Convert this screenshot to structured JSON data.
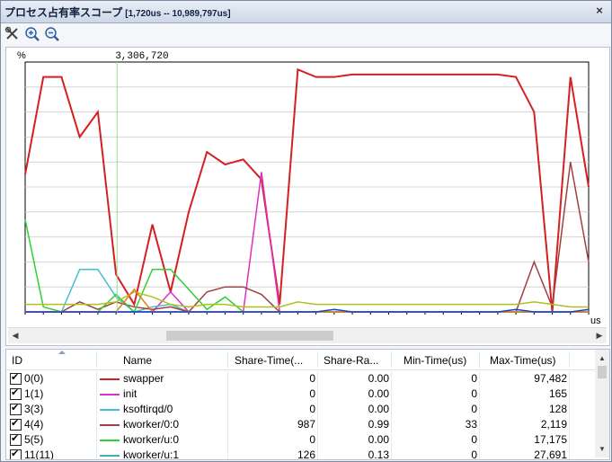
{
  "window": {
    "title": "プロセス占有率スコープ",
    "range": "[1,720us -- 10,989,797us]",
    "close_label": "×"
  },
  "toolbar": {
    "icons": [
      "settings-icon",
      "zoom-in-icon",
      "zoom-out-icon"
    ]
  },
  "chart_data": {
    "type": "line",
    "ylabel": "%",
    "xlabel": "us",
    "cursor_label": "3,306,720",
    "ylim": [
      0,
      100
    ],
    "grid": true,
    "x": [
      0,
      1,
      2,
      3,
      4,
      5,
      6,
      7,
      8,
      9,
      10,
      11,
      12,
      13,
      14,
      15,
      16,
      17,
      18,
      19,
      20,
      21,
      22,
      23,
      24,
      25,
      26,
      27,
      28,
      29,
      30,
      31
    ],
    "series": [
      {
        "name": "swapper",
        "color": "#d42020",
        "values": [
          55,
          94,
          94,
          70,
          80,
          15,
          3,
          35,
          8,
          40,
          64,
          59,
          61,
          53,
          3,
          97,
          94,
          94,
          95,
          95,
          95,
          95,
          95,
          95,
          95,
          95,
          95,
          94,
          80,
          0,
          94,
          50
        ]
      },
      {
        "name": "init",
        "color": "#e030c0",
        "values": [
          0,
          0,
          0,
          0,
          0,
          0,
          0,
          0,
          8,
          0,
          0,
          0,
          0,
          56,
          0,
          0,
          0,
          0,
          0,
          0,
          0,
          0,
          0,
          0,
          0,
          0,
          0,
          0,
          0,
          0,
          0,
          0
        ]
      },
      {
        "name": "ksoftirqd/0",
        "color": "#40c0d0",
        "values": [
          0,
          0,
          0,
          17,
          17,
          6,
          0,
          2,
          3,
          0,
          0,
          0,
          0,
          0,
          0,
          0,
          0,
          0,
          0,
          0,
          0,
          0,
          0,
          0,
          0,
          0,
          0,
          0,
          0,
          0,
          0,
          0
        ]
      },
      {
        "name": "kworker/0:0",
        "color": "#a04040",
        "values": [
          0,
          0,
          0,
          4,
          1,
          4,
          2,
          1,
          2,
          0,
          8,
          10,
          10,
          7,
          0,
          0,
          0,
          0,
          0,
          0,
          0,
          0,
          0,
          0,
          0,
          0,
          0,
          0,
          20,
          2,
          60,
          20
        ]
      },
      {
        "name": "kworker/u:0",
        "color": "#30d030",
        "values": [
          37,
          2,
          0,
          0,
          0,
          7,
          0,
          17,
          17,
          9,
          1,
          6,
          0,
          0,
          0,
          0,
          0,
          0,
          0,
          0,
          0,
          0,
          0,
          0,
          0,
          0,
          0,
          0,
          0,
          0,
          0,
          0
        ]
      },
      {
        "name": "kworker/u:1",
        "color": "#40b0b0",
        "values": [
          0,
          0,
          0,
          0,
          0,
          0,
          0,
          0,
          0,
          0,
          0,
          0,
          0,
          0,
          0,
          0,
          0,
          0,
          0,
          0,
          0,
          0,
          0,
          0,
          0,
          0,
          0,
          0,
          0,
          0,
          0,
          0
        ]
      },
      {
        "name": "",
        "color": "#b0c020",
        "values": [
          3,
          3,
          3,
          3,
          3,
          4,
          8,
          6,
          3,
          2,
          3,
          3,
          2,
          2,
          2,
          4,
          3,
          3,
          3,
          3,
          3,
          3,
          3,
          3,
          3,
          3,
          3,
          3,
          4,
          3,
          2,
          2
        ]
      },
      {
        "name": "",
        "color": "#e08020",
        "values": [
          0,
          0,
          0,
          0,
          0,
          0,
          9,
          0,
          0,
          0,
          0,
          0,
          0,
          0,
          0,
          0,
          0,
          0,
          0,
          0,
          0,
          0,
          0,
          0,
          0,
          0,
          0,
          0,
          0,
          0,
          0,
          0
        ]
      },
      {
        "name": "",
        "color": "#2040c0",
        "values": [
          0,
          0,
          0,
          0,
          0,
          0,
          0,
          0,
          0,
          0,
          0,
          0,
          0,
          0,
          0,
          0,
          0,
          1,
          0,
          0,
          0,
          0,
          0,
          0,
          0,
          0,
          0,
          1,
          0,
          0,
          0,
          1
        ]
      }
    ]
  },
  "table": {
    "columns": [
      "ID",
      "Name",
      "Share-Time(...",
      "Share-Ra...",
      "Min-Time(us)",
      "Max-Time(us)"
    ],
    "rows": [
      {
        "id": "0(0)",
        "name": "swapper",
        "color": "#d42020",
        "share_time": "0",
        "share_rate": "0.00",
        "min_time": "0",
        "max_time": "97,482"
      },
      {
        "id": "1(1)",
        "name": "init",
        "color": "#e030c0",
        "share_time": "0",
        "share_rate": "0.00",
        "min_time": "0",
        "max_time": "165"
      },
      {
        "id": "3(3)",
        "name": "ksoftirqd/0",
        "color": "#40c0d0",
        "share_time": "0",
        "share_rate": "0.00",
        "min_time": "0",
        "max_time": "128"
      },
      {
        "id": "4(4)",
        "name": "kworker/0:0",
        "color": "#a04040",
        "share_time": "987",
        "share_rate": "0.99",
        "min_time": "33",
        "max_time": "2,119"
      },
      {
        "id": "5(5)",
        "name": "kworker/u:0",
        "color": "#30d030",
        "share_time": "0",
        "share_rate": "0.00",
        "min_time": "0",
        "max_time": "17,175"
      },
      {
        "id": "11(11)",
        "name": "kworker/u:1",
        "color": "#40b0b0",
        "share_time": "126",
        "share_rate": "0.13",
        "min_time": "0",
        "max_time": "27,691"
      }
    ]
  }
}
